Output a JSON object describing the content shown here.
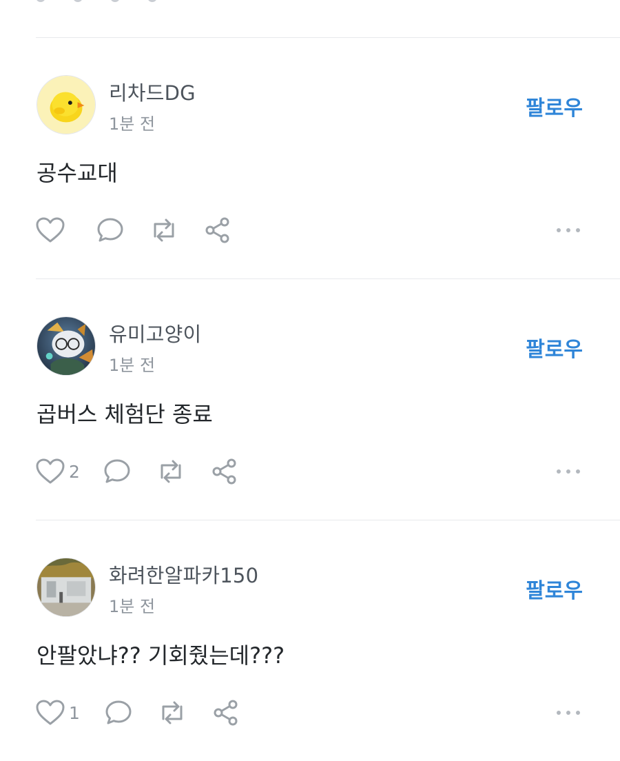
{
  "colors": {
    "follow_accent": "#2f85d8",
    "icon_gray": "#9aa0a6",
    "divider": "#e7e9ec"
  },
  "posts": [
    {
      "author": "리차드DG",
      "time": "1분 전",
      "follow_label": "팔로우",
      "content": "공수교대",
      "like_count": "",
      "avatar": "yellow-chick"
    },
    {
      "author": "유미고양이",
      "time": "1분 전",
      "follow_label": "팔로우",
      "content": "곱버스 체험단 종료",
      "like_count": "2",
      "avatar": "game-character"
    },
    {
      "author": "화려한알파카150",
      "time": "1분 전",
      "follow_label": "팔로우",
      "content": "안팔았냐??  기회줬는데???",
      "like_count": "1",
      "avatar": "street-photo"
    }
  ],
  "icons": [
    "heart-icon",
    "comment-icon",
    "repost-icon",
    "share-icon",
    "more-icon"
  ]
}
